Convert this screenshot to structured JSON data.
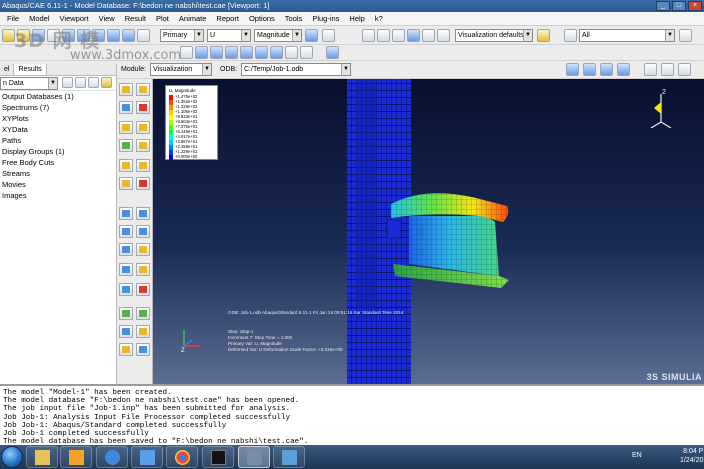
{
  "window": {
    "title": "Abaqus/CAE 6.11-1 - Model Database: F:\\bedon ne nabshi\\test.cae [Viewport: 1]"
  },
  "menu": [
    "File",
    "Model",
    "Viewport",
    "View",
    "Result",
    "Plot",
    "Animate",
    "Report",
    "Options",
    "Tools",
    "Plug-ins",
    "Help",
    "k?"
  ],
  "toolbar": {
    "step_select": "Primary",
    "variable_select": "U",
    "invariant_select": "Magnitude",
    "render_style": "Visualization defaults",
    "selection_filter": "All",
    "module_label": "Module:",
    "module_value": "Visualization",
    "odb_label": "ODB:",
    "odb_value": "C:/Temp/Job-1.odb"
  },
  "watermark": {
    "logo": "3D 网 模",
    "url": "www.3dmox.com"
  },
  "left_panel": {
    "tabs": [
      "el",
      "Results"
    ],
    "active_tab": "Results",
    "data_select": "n Data",
    "tree": [
      "Output Databases (1)",
      "Spectrums (7)",
      "XYPlots",
      "XYData",
      "Paths",
      "Display Groups (1)",
      "Free Body Cuts",
      "Streams",
      "Movies",
      "Images"
    ]
  },
  "legend": {
    "title": "U, Magnitude",
    "values": [
      "+1.475e+02",
      "+1.352e+02",
      "+1.229e+02",
      "+1.106e+02",
      "+9.833e+01",
      "+8.604e+01",
      "+7.375e+01",
      "+6.146e+01",
      "+4.917e+01",
      "+3.687e+01",
      "+2.458e+01",
      "+1.229e+01",
      "+0.000e+00"
    ],
    "colors": [
      "#ff0000",
      "#ff4a00",
      "#ff9400",
      "#ffd200",
      "#f4ff00",
      "#a9ff00",
      "#4cff00",
      "#00ff5a",
      "#00ffc0",
      "#00d4ff",
      "#0080ff",
      "#0033ff",
      "#0000d8"
    ]
  },
  "viewport": {
    "odb_info": "ODB: Job-1.odb    Abaqus/Standard 6.11-1    Fri Jan 24 09:51:16 Sar Standard Time 2014",
    "step_info": [
      "Step: Step-1",
      "Increment    7: Step Time =    1.000",
      "Primary Var: U, Magnitude",
      "Deformed Var: U   Deformation Scale Factor: +3.316e+00"
    ],
    "brand": "3S SIMULIA",
    "triad_z": "2",
    "triad_y": "Y",
    "triad_x": "X",
    "axes_z": "Z"
  },
  "messages": [
    "The model \"Model-1\" has been created.",
    "The model database \"F:\\bedon ne nabshi\\test.cae\" has been opened.",
    "The job input file \"Job-1.inp\" has been submitted for analysis.",
    "Job Job-1: Analysis Input File Processor completed successfully",
    "Job Job-1: Abaqus/Standard completed successfully",
    "Job Job-1 completed successfully",
    "The model database has been saved to \"F:\\bedon ne nabshi\\test.cae\"."
  ],
  "taskbar": {
    "lang": "EN",
    "time": "8:04 P",
    "date": "1/24/20"
  }
}
